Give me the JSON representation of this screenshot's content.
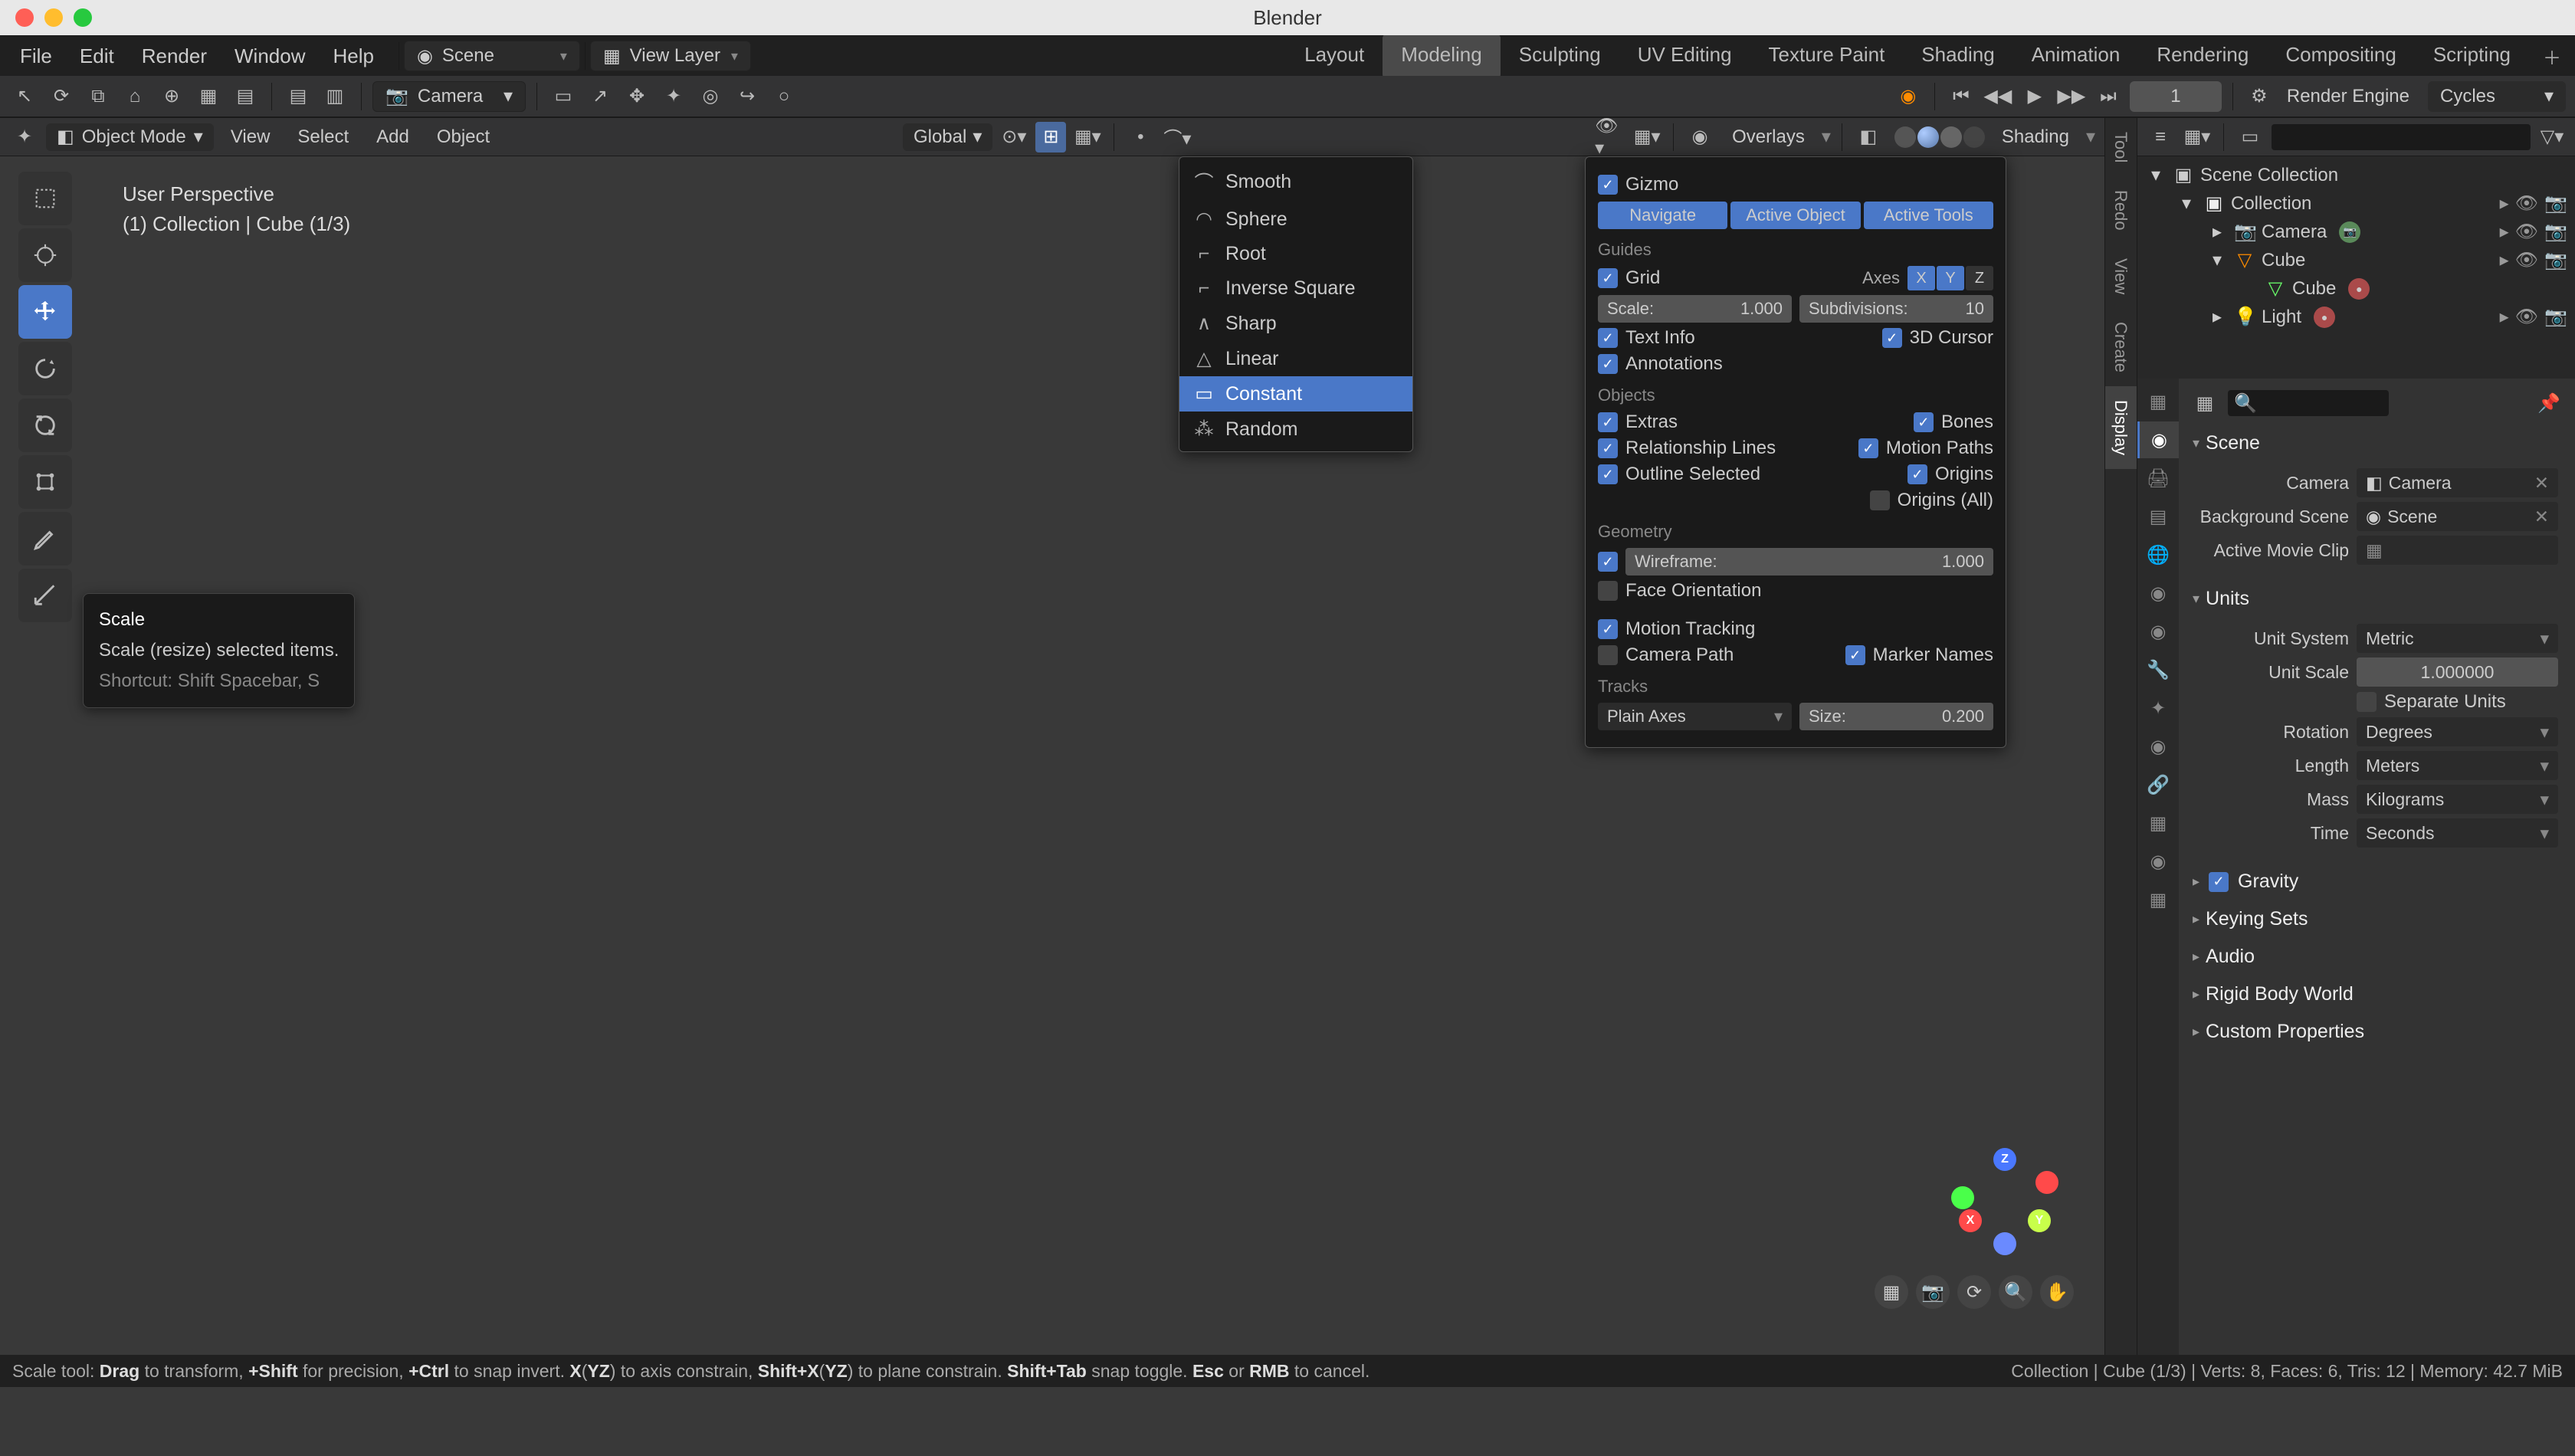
{
  "title": "Blender",
  "menubar": [
    "File",
    "Edit",
    "Render",
    "Window",
    "Help"
  ],
  "scene_sel": "Scene",
  "viewlayer_sel": "View Layer",
  "workspace_tabs": [
    "Layout",
    "Modeling",
    "Sculpting",
    "UV Editing",
    "Texture Paint",
    "Shading",
    "Animation",
    "Rendering",
    "Compositing",
    "Scripting"
  ],
  "workspace_active": "Modeling",
  "camera_sel": "Camera",
  "frame": "1",
  "render_engine_label": "Render Engine",
  "render_engine": "Cycles",
  "viewport": {
    "mode": "Object Mode",
    "menus": [
      "View",
      "Select",
      "Add",
      "Object"
    ],
    "orient": "Global",
    "overlays_label": "Overlays",
    "shading_label": "Shading",
    "info_line1": "User Perspective",
    "info_line2": "(1) Collection | Cube (1/3)",
    "tooltip": {
      "title": "Scale",
      "desc": "Scale (resize) selected items.",
      "sc": "Shortcut: Shift Spacebar, S"
    }
  },
  "falloff": [
    "Smooth",
    "Sphere",
    "Root",
    "Inverse Square",
    "Sharp",
    "Linear",
    "Constant",
    "Random"
  ],
  "falloff_sel": "Constant",
  "overlay": {
    "gizmo": "Gizmo",
    "btns": [
      "Navigate",
      "Active Object",
      "Active Tools"
    ],
    "guides": "Guides",
    "grid": "Grid",
    "axes_lbl": "Axes",
    "axes": [
      "X",
      "Y",
      "Z"
    ],
    "scale": "Scale:",
    "scale_v": "1.000",
    "subdiv": "Subdivisions:",
    "subdiv_v": "10",
    "textinfo": "Text Info",
    "cursor3d": "3D Cursor",
    "annot": "Annotations",
    "objects": "Objects",
    "extras": "Extras",
    "bones": "Bones",
    "rel": "Relationship Lines",
    "mpaths": "Motion Paths",
    "outsel": "Outline Selected",
    "origins": "Origins",
    "originsall": "Origins (All)",
    "geometry": "Geometry",
    "wireframe": "Wireframe:",
    "wireframe_v": "1.000",
    "faceo": "Face Orientation",
    "mtrack": "Motion Tracking",
    "cpath": "Camera Path",
    "mnames": "Marker Names",
    "tracks": "Tracks",
    "plainaxes": "Plain Axes",
    "size": "Size:",
    "size_v": "0.200"
  },
  "side_tabs": [
    "Tool",
    "Redo",
    "View",
    "Create",
    "Display"
  ],
  "outliner": {
    "root": "Scene Collection",
    "collection": "Collection",
    "items": [
      "Camera",
      "Cube",
      "Cube",
      "Light"
    ]
  },
  "props": {
    "scene": "Scene",
    "camera_lbl": "Camera",
    "camera_v": "Camera",
    "bg_lbl": "Background Scene",
    "bg_v": "Scene",
    "clip_lbl": "Active Movie Clip",
    "units": "Units",
    "usys_lbl": "Unit System",
    "usys_v": "Metric",
    "uscale_lbl": "Unit Scale",
    "uscale_v": "1.000000",
    "sep_lbl": "Separate Units",
    "rot_lbl": "Rotation",
    "rot_v": "Degrees",
    "len_lbl": "Length",
    "len_v": "Meters",
    "mass_lbl": "Mass",
    "mass_v": "Kilograms",
    "time_lbl": "Time",
    "time_v": "Seconds",
    "panels": [
      "Gravity",
      "Keying Sets",
      "Audio",
      "Rigid Body World",
      "Custom Properties"
    ]
  },
  "statusbar": {
    "left_html": "Scale tool: <b>Drag</b> to transform, <b>+Shift</b> for precision, <b>+Ctrl</b> to snap invert. <b>X</b>(<b>YZ</b>) to axis constrain, <b>Shift+X</b>(<b>YZ</b>) to plane constrain. <b>Shift+Tab</b> snap toggle. <b>Esc</b> or <b>RMB</b> to cancel.",
    "right": "Collection | Cube (1/3) | Verts: 8, Faces: 6, Tris: 12 | Memory: 42.7 MiB"
  }
}
